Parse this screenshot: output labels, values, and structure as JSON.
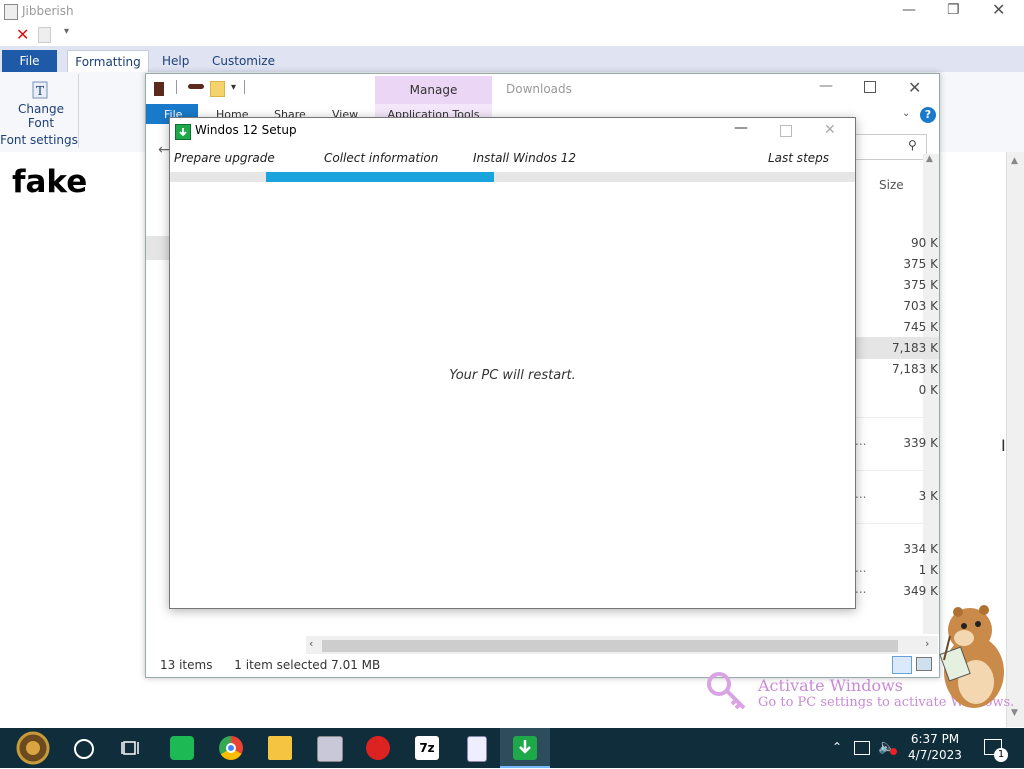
{
  "background_app": {
    "title": "Jibberish",
    "ribbon_tabs": [
      "File",
      "Formatting",
      "Help",
      "Customize"
    ],
    "ribbon_group": {
      "button_line1": "Change",
      "button_line2": "Font",
      "group_label": "Font settings"
    },
    "document_text": "fake"
  },
  "explorer": {
    "manage_tab": "Manage",
    "application_tools": "Application Tools",
    "location": "Downloads",
    "tabs": [
      "File",
      "Home",
      "Share",
      "View"
    ],
    "size_header": "Size",
    "sizes": [
      "90 K",
      "375 K",
      "375 K",
      "703 K",
      "745 K",
      "7,183 K",
      "7,183 K",
      "0 K",
      "339 K",
      "3 K",
      "334 K",
      "1 K",
      "349 K"
    ],
    "truncated": [
      "...",
      "...",
      "...",
      "..."
    ],
    "status_items": "13 items",
    "status_selected": "1 item selected  7.01 MB"
  },
  "setup_dialog": {
    "title": "Windos 12 Setup",
    "steps": [
      "Prepare upgrade",
      "Collect information",
      "Install Windos 12",
      "Last steps"
    ],
    "progress_fraction": 0.33,
    "message": "Your PC will restart."
  },
  "watermark": {
    "line1": "Activate Windows",
    "line2": "Go to PC settings to activate Windows."
  },
  "taskbar": {
    "time": "6:37 PM",
    "date": "4/7/2023",
    "notification_count": "1",
    "icons": [
      "start-icon",
      "cortana-icon",
      "task-view-icon",
      "spotify-icon",
      "chrome-icon",
      "file-explorer-icon",
      "app-icon",
      "app-red-icon",
      "7zip-icon",
      "notepad-icon",
      "setup-icon"
    ]
  },
  "colors": {
    "taskbar": "#0f2d3a",
    "progress": "#1ba3dd",
    "manage_tab": "#ecd6f5",
    "file_tab_blue": "#1979ca"
  }
}
